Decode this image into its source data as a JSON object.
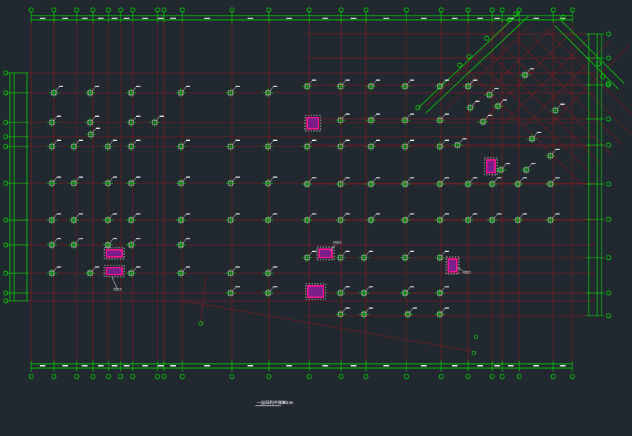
{
  "canvas": {
    "background": "#212830"
  },
  "colors": {
    "grid_line": "#8b1a1a",
    "dimension": "#00e600",
    "column": "#e8e8e8",
    "column_accent": "#00d000",
    "highlight": "#ff1493",
    "highlight_fill": "#7a1f8a",
    "label": "#ffffff"
  },
  "drawing": {
    "title": "一层结构平面图",
    "scale_note": "1:100"
  },
  "axes": {
    "top": [
      "1",
      "2",
      "3",
      "4",
      "5",
      "6",
      "7",
      "8",
      "9",
      "10",
      "11",
      "12",
      "13",
      "14",
      "15",
      "16",
      "17",
      "18",
      "19",
      "20",
      "21",
      "22"
    ],
    "left": [
      "A",
      "B",
      "C",
      "D",
      "E",
      "F",
      "G",
      "H",
      "J",
      "K",
      "L",
      "M",
      "N"
    ],
    "right": [
      "A",
      "B",
      "C",
      "D",
      "E",
      "F",
      "G",
      "H",
      "J",
      "K"
    ]
  },
  "annotations": {
    "note_a": "柱加大",
    "note_b": "柱加大",
    "note_c": "柱加大"
  }
}
